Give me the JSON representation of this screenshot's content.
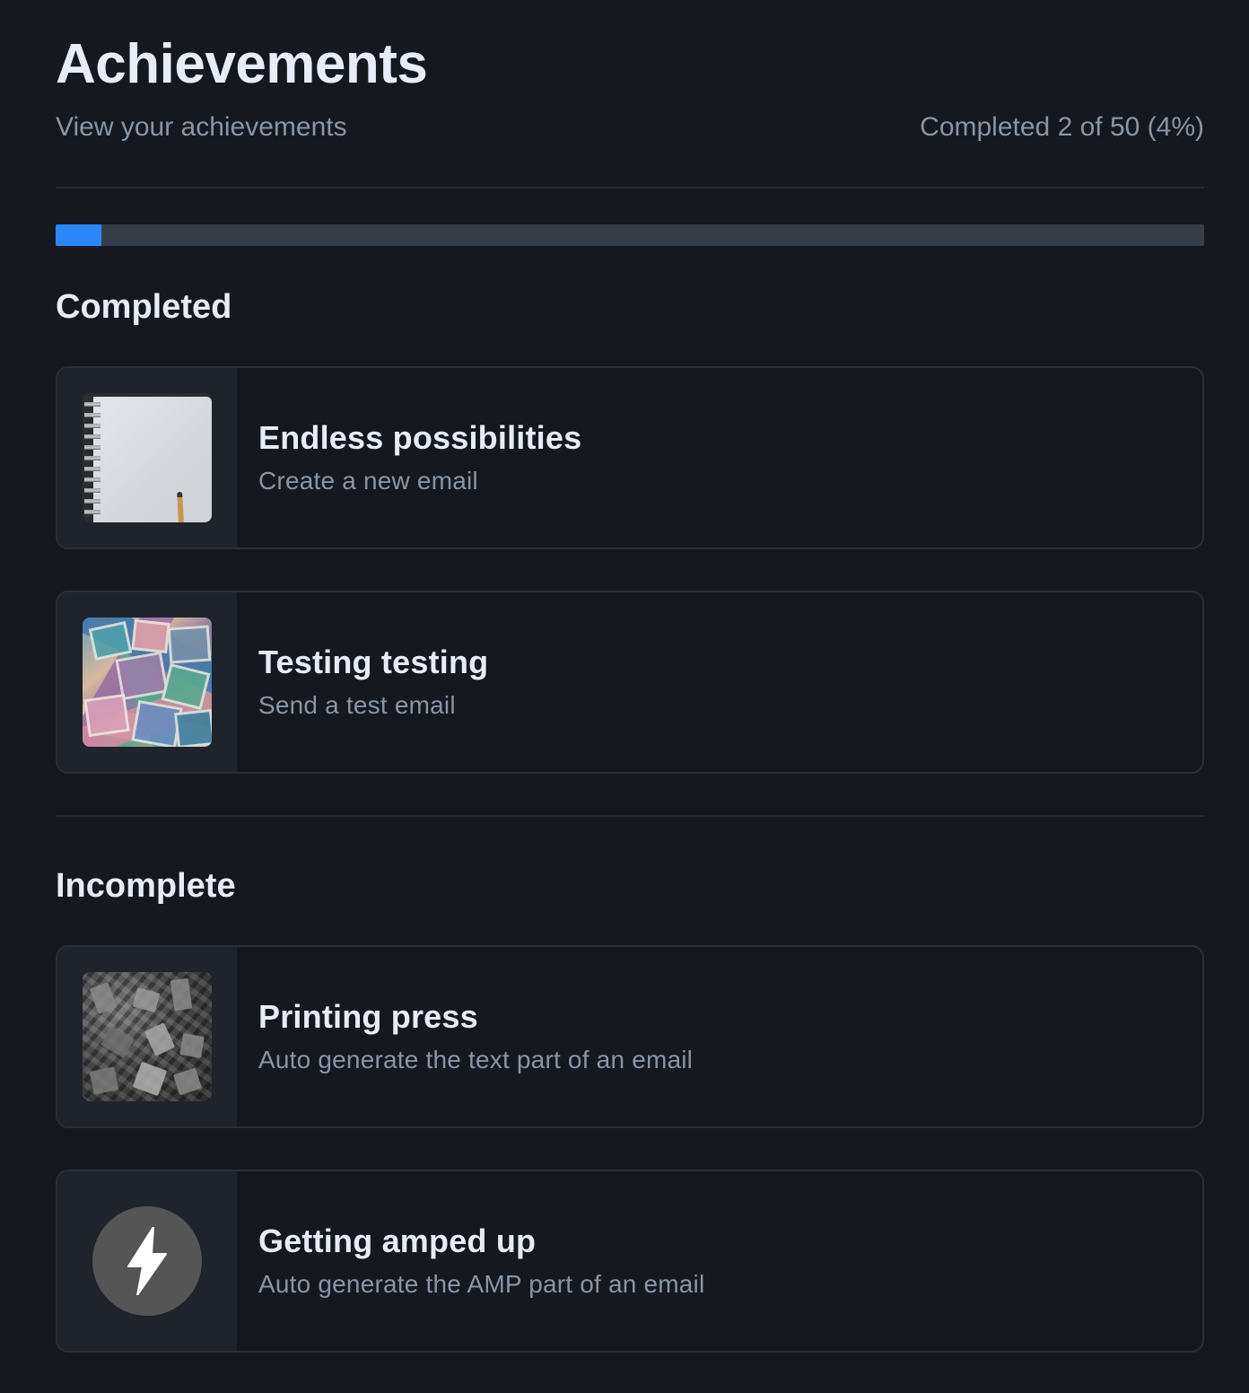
{
  "header": {
    "title": "Achievements",
    "subtitle": "View your achievements",
    "progress_text": "Completed 2 of 50 (4%)"
  },
  "progress": {
    "completed": 2,
    "total": 50,
    "percent": 4,
    "fill_color": "#2a88fc",
    "track_color": "#373e48"
  },
  "sections": {
    "completed": {
      "title": "Completed",
      "items": [
        {
          "title": "Endless possibilities",
          "description": "Create a new email",
          "image": "notebook-and-pencil-photo"
        },
        {
          "title": "Testing testing",
          "description": "Send a test email",
          "image": "postage-stamps-photo"
        }
      ]
    },
    "incomplete": {
      "title": "Incomplete",
      "items": [
        {
          "title": "Printing press",
          "description": "Auto generate the text part of an email",
          "image": "letterpress-type-photo"
        },
        {
          "title": "Getting amped up",
          "description": "Auto generate the AMP part of an email",
          "image": "lightning-bolt-icon"
        }
      ]
    }
  }
}
